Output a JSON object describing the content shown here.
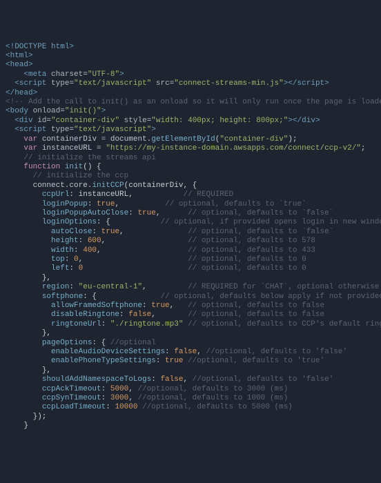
{
  "l0": "<!DOCTYPE html>",
  "l1": "<html>",
  "l2": "<head>",
  "l3a": "<meta",
  "l3b": "charset",
  "l3c": "\"UTF-8\"",
  "l3d": ">",
  "l4a": "<script",
  "l4b": "type",
  "l4c": "\"text/javascript\"",
  "l4d": "src",
  "l4e": "\"connect-streams-min.js\"",
  "l4f": "></",
  "l4g": "script",
  "l4h": ">",
  "l5": "</head>",
  "l6": "<!-- Add the call to init() as an onload so it will only run once the page is loaded -->",
  "l7a": "<body",
  "l7b": "onload",
  "l7c": "\"init()\"",
  "l7d": ">",
  "l8a": "<div",
  "l8b": "id",
  "l8c": "\"container-div\"",
  "l8d": "style",
  "l8e": "\"width: 400px; height: 800px;\"",
  "l8f": "></",
  "l8g": "div",
  "l8h": ">",
  "l9a": "<script",
  "l9b": "type",
  "l9c": "\"text/javascript\"",
  "l9d": ">",
  "l10a": "var",
  "l10b": "containerDiv = ",
  "l10c": "document",
  "l10d": ".",
  "l10e": "getElementById",
  "l10f": "(",
  "l10g": "\"container-div\"",
  "l10h": ");",
  "l11a": "var",
  "l11b": "instanceURL = ",
  "l11c": "\"https://my-instance-domain.awsapps.com/connect/ccp-v2/\"",
  "l11d": ";",
  "l12": "// initialize the streams api",
  "l13a": "function",
  "l13b": "init",
  "l13c": "() {",
  "l14": "// initialize the ccp",
  "l15a": "connect.core.",
  "l15b": "initCCP",
  "l15c": "(containerDiv, {",
  "l16a": "ccpUrl",
  "l16b": ": instanceURL,",
  "l16c": "// REQUIRED",
  "l17a": "loginPopup",
  "l17b": ": ",
  "l17c": "true",
  "l17d": ",",
  "l17e": "// optional, defaults to `true`",
  "l18a": "loginPopupAutoClose",
  "l18b": ": ",
  "l18c": "true",
  "l18d": ",",
  "l18e": "// optional, defaults to `false`",
  "l19a": "loginOptions",
  "l19b": ": {",
  "l19c": "// optional, if provided opens login in new window",
  "l20a": "autoClose",
  "l20b": ": ",
  "l20c": "true",
  "l20d": ",",
  "l20e": "// optional, defaults to `false`",
  "l21a": "height",
  "l21b": ": ",
  "l21c": "600",
  "l21d": ",",
  "l21e": "// optional, defaults to 578",
  "l22a": "width",
  "l22b": ": ",
  "l22c": "400",
  "l22d": ",",
  "l22e": "// optional, defaults to 433",
  "l23a": "top",
  "l23b": ": ",
  "l23c": "0",
  "l23d": ",",
  "l23e": "// optional, defaults to 0",
  "l24a": "left",
  "l24b": ": ",
  "l24c": "0",
  "l24d": "// optional, defaults to 0",
  "l25": "},",
  "l26a": "region",
  "l26b": ": ",
  "l26c": "\"eu-central-1\"",
  "l26d": ",",
  "l26e": "// REQUIRED for `CHAT`, optional otherwise",
  "l27a": "softphone",
  "l27b": ": {",
  "l27c": "// optional, defaults below apply if not provided",
  "l28a": "allowFramedSoftphone",
  "l28b": ": ",
  "l28c": "true",
  "l28d": ",",
  "l28e": "// optional, defaults to false",
  "l29a": "disableRingtone",
  "l29b": ": ",
  "l29c": "false",
  "l29d": ",",
  "l29e": "// optional, defaults to false",
  "l30a": "ringtoneUrl",
  "l30b": ": ",
  "l30c": "\"./ringtone.mp3\"",
  "l30d": " // optional, defaults to CCP's default ringtone if a falsy value is ",
  "l31": "},",
  "l32a": "pageOptions",
  "l32b": ": { ",
  "l32c": "//optional",
  "l33a": "enableAudioDeviceSettings",
  "l33b": ": ",
  "l33c": "false",
  "l33d": ", ",
  "l33e": "//optional, defaults to 'false'",
  "l34a": "enablePhoneTypeSettings",
  "l34b": ": ",
  "l34c": "true",
  "l34d": " ",
  "l34e": "//optional, defaults to 'true'",
  "l35": "},",
  "l36a": "shouldAddNamespaceToLogs",
  "l36b": ": ",
  "l36c": "false",
  "l36d": ", ",
  "l36e": "//optional, defaults to 'false'",
  "l37a": "ccpAckTimeout",
  "l37b": ": ",
  "l37c": "5000",
  "l37d": ", ",
  "l37e": "//optional, defaults to 3000 (ms)",
  "l38a": "ccpSynTimeout",
  "l38b": ": ",
  "l38c": "3000",
  "l38d": ", ",
  "l38e": "//optional, defaults to 1000 (ms)",
  "l39a": "ccpLoadTimeout",
  "l39b": ": ",
  "l39c": "10000",
  "l39d": " ",
  "l39e": "//optional, defaults to 5000 (ms)",
  "l40": "});",
  "l41": "}"
}
